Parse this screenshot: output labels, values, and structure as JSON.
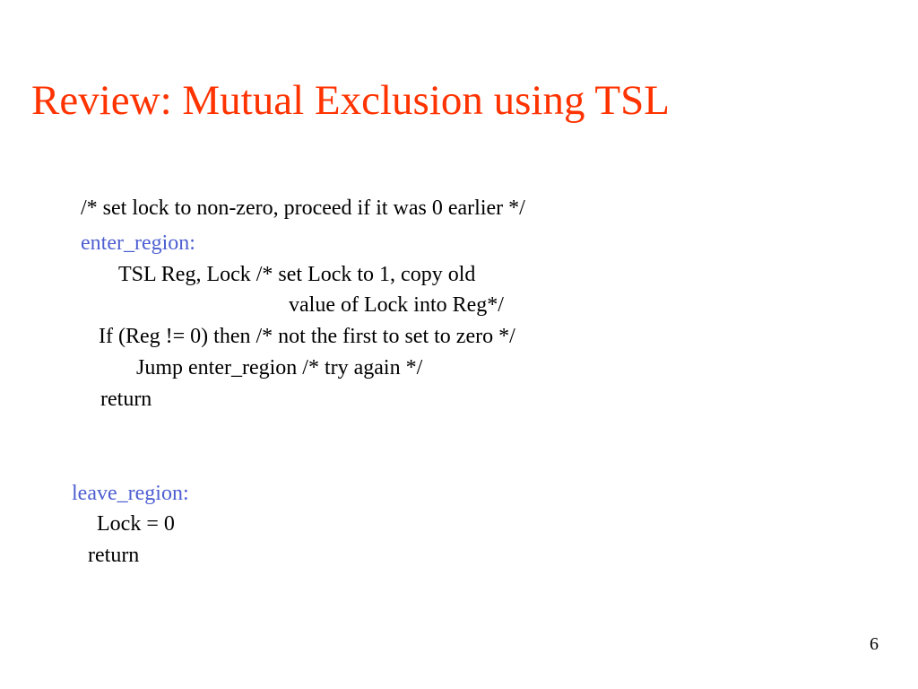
{
  "title": "Review: Mutual Exclusion using TSL",
  "comment_top": "/* set lock to non-zero, proceed if it was 0 earlier */",
  "enter_label": "enter_region:",
  "tsl_line_a": "TSL  Reg, Lock  /* set Lock to 1, copy old",
  "tsl_line_b": "value of Lock into Reg*/",
  "if_line": "If (Reg != 0) then    /* not the first to set to zero */",
  "jump_line": "Jump enter_region  /* try again */",
  "return1": "return",
  "leave_label": "leave_region:",
  "lock_zero": "Lock  =  0",
  "return2": "return",
  "page_number": "6"
}
